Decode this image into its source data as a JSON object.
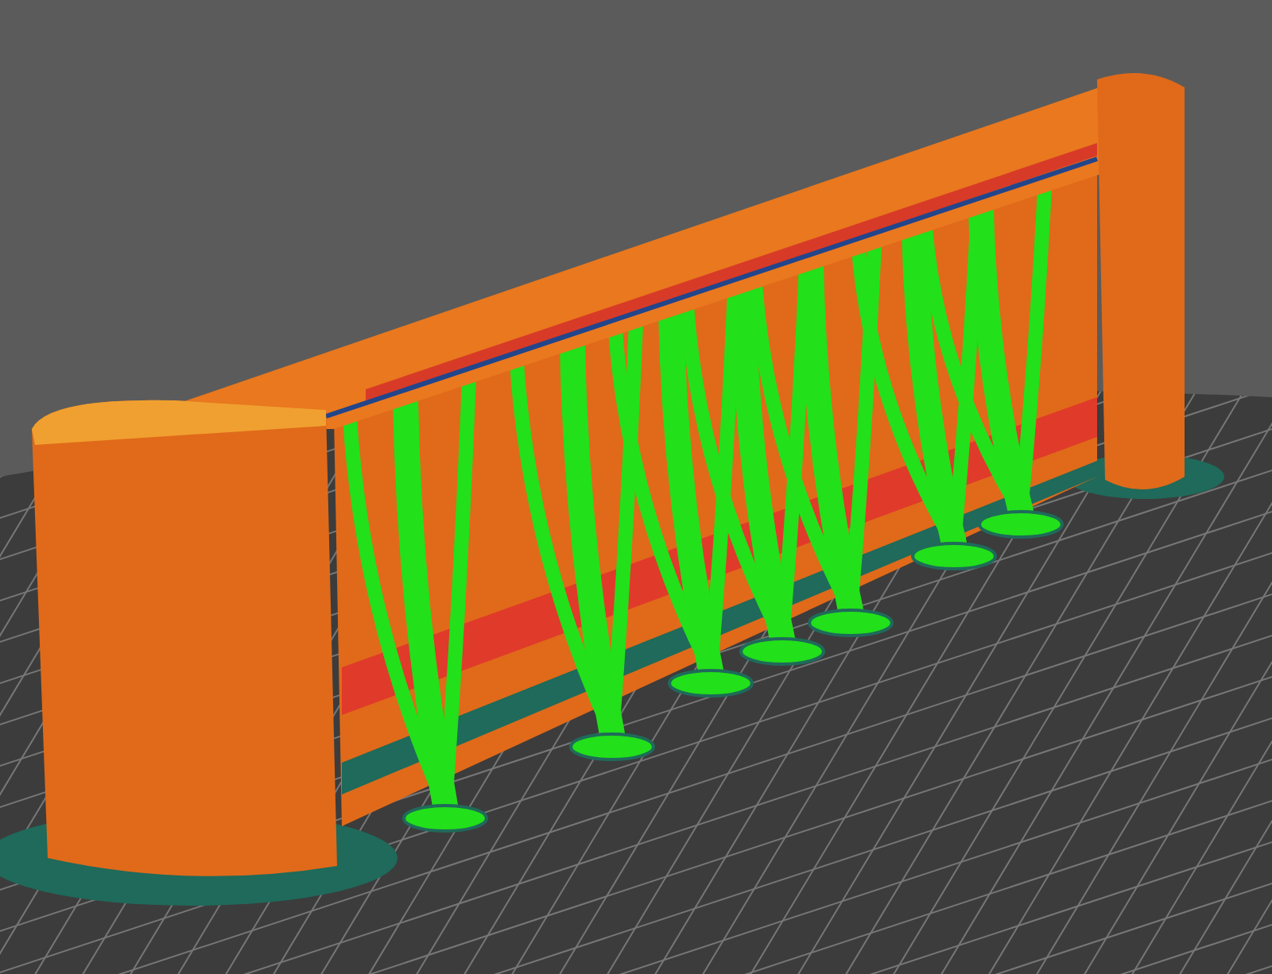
{
  "scene": {
    "kind": "slicer-preview"
  }
}
